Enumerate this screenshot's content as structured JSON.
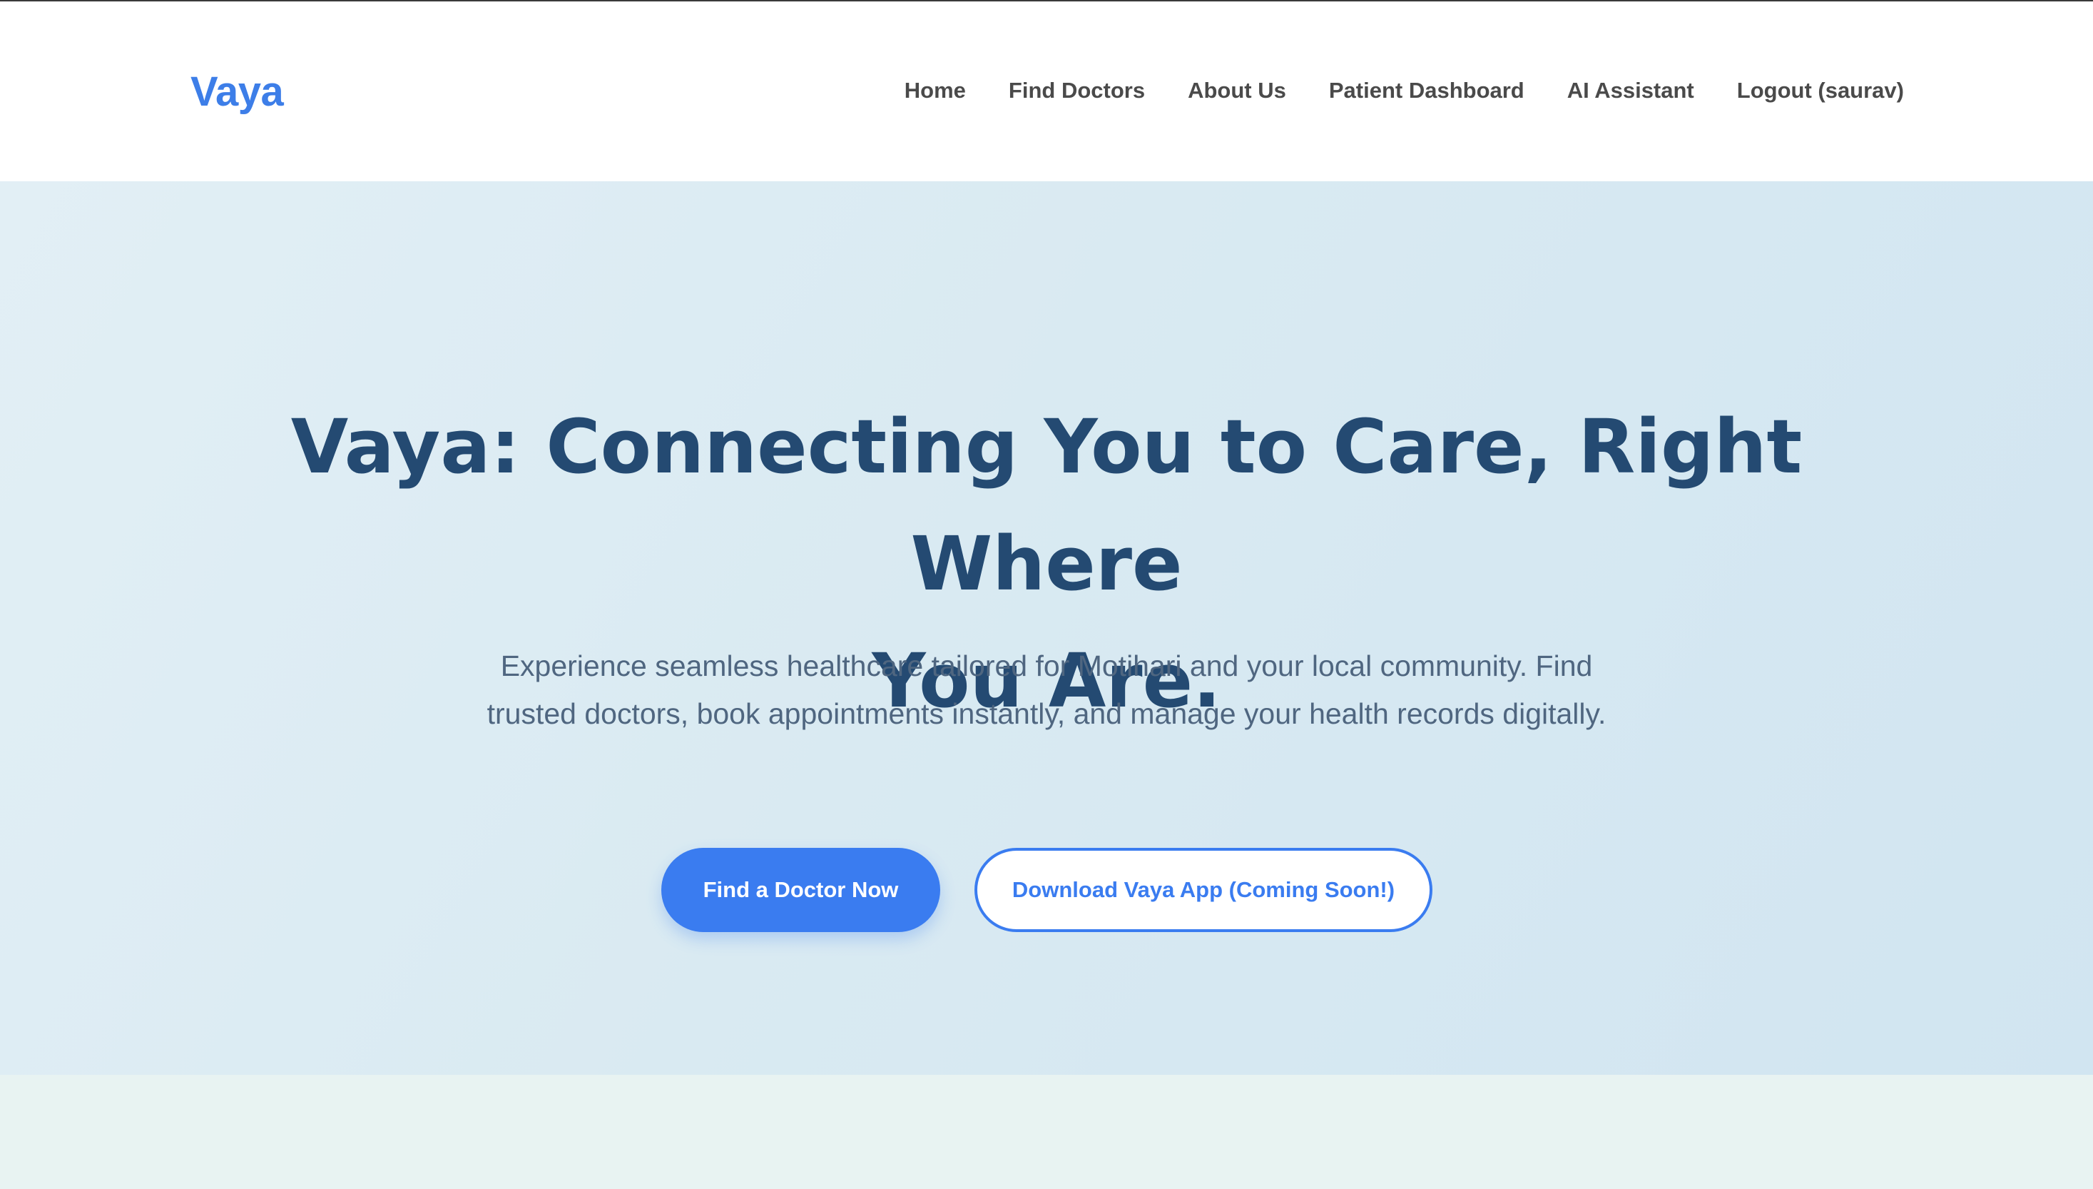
{
  "header": {
    "logo": "Vaya",
    "nav": [
      {
        "label": "Home"
      },
      {
        "label": "Find Doctors"
      },
      {
        "label": "About Us"
      },
      {
        "label": "Patient Dashboard"
      },
      {
        "label": "AI Assistant"
      },
      {
        "label": "Logout (saurav)"
      }
    ]
  },
  "hero": {
    "title_line1": "Vaya: Connecting You to Care, Right Where",
    "title_line2": "You Are.",
    "subtitle": "Experience seamless healthcare tailored for Motihari and your local community. Find trusted doctors, book appointments instantly, and manage your health records digitally.",
    "primary_button": "Find a Doctor Now",
    "secondary_button": "Download Vaya App (Coming Soon!)"
  },
  "colors": {
    "brand": "#3d7ee8",
    "heading": "#244a72",
    "button_primary": "#3a7cf0"
  }
}
